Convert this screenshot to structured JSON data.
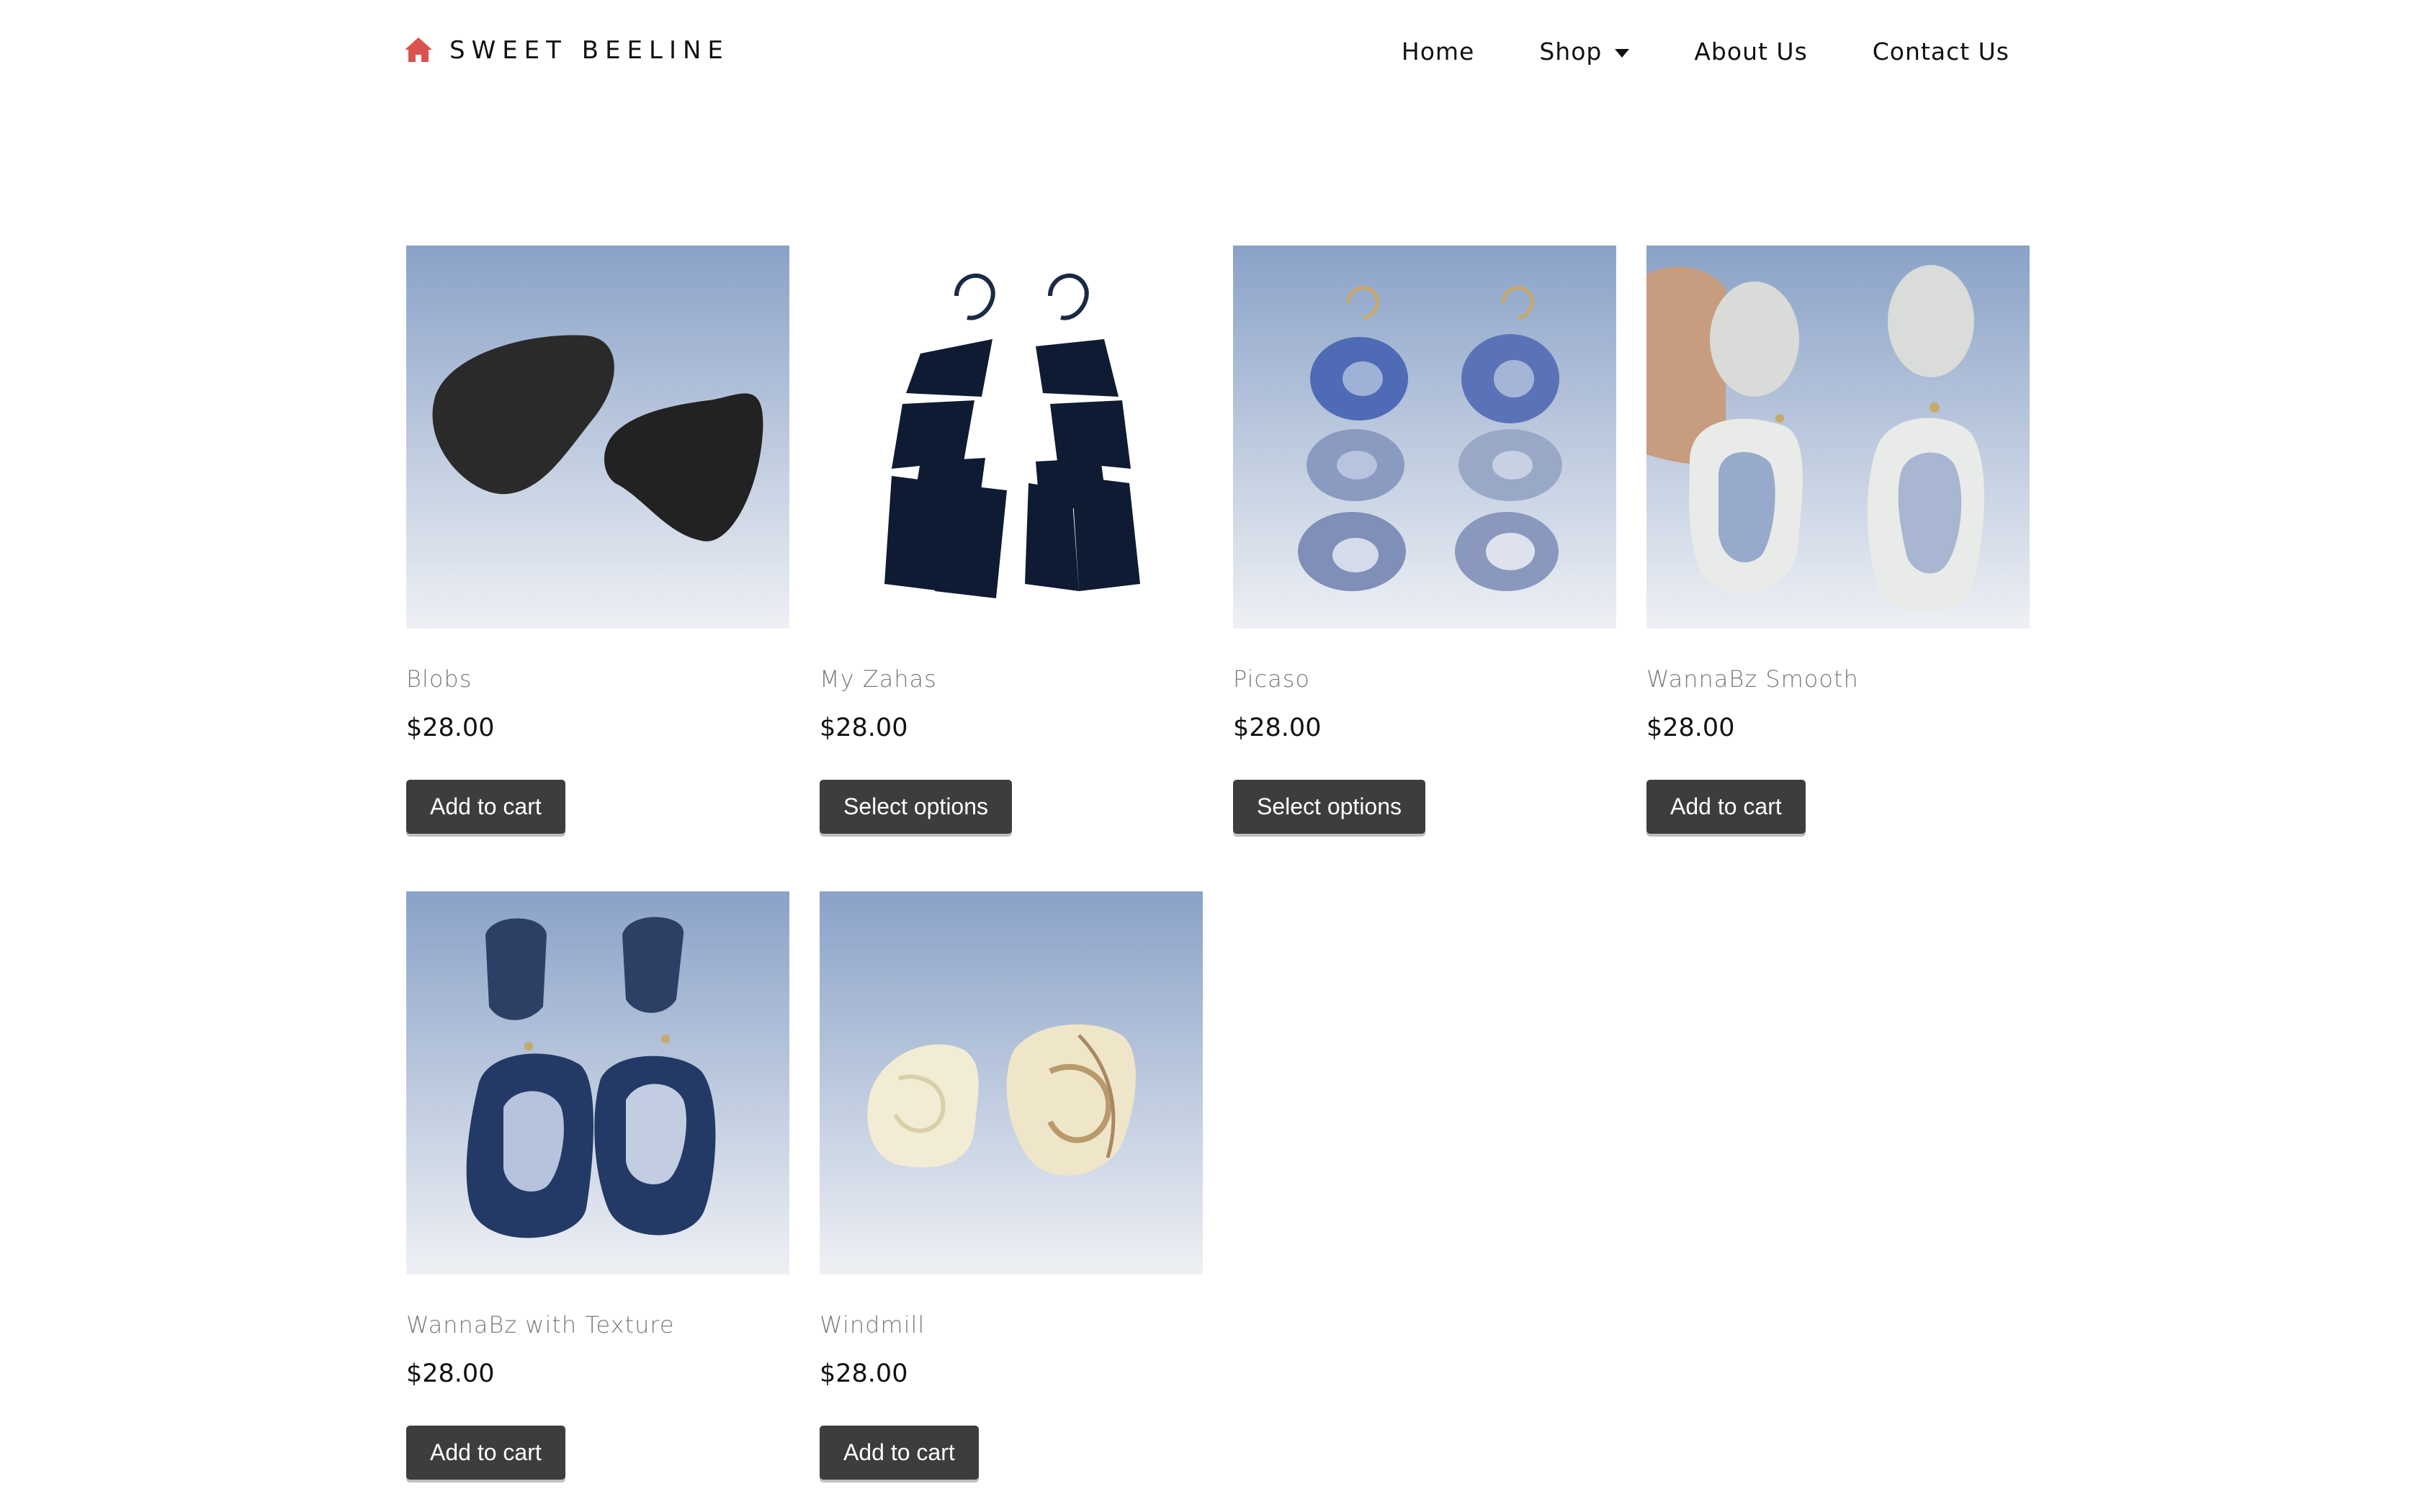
{
  "site": {
    "brand_name": "SWEET BEELINE",
    "brand_icon": "home-icon",
    "accent_color": "#d9534f"
  },
  "nav": {
    "items": [
      {
        "label": "Home"
      },
      {
        "label": "Shop",
        "has_dropdown": true
      },
      {
        "label": "About Us"
      },
      {
        "label": "Contact Us"
      }
    ]
  },
  "products": [
    {
      "title": "Blobs",
      "price": "$28.00",
      "button": "Add to cart",
      "image": "black-blob-earrings"
    },
    {
      "title": "My Zahas",
      "price": "$28.00",
      "button": "Select options",
      "image": "navy-geometric-dangle-earrings"
    },
    {
      "title": "Picaso",
      "price": "$28.00",
      "button": "Select options",
      "image": "blue-hoop-chain-earrings"
    },
    {
      "title": "WannaBz Smooth",
      "price": "$28.00",
      "button": "Add to cart",
      "image": "white-stone-drop-earrings"
    },
    {
      "title": "WannaBz with Texture",
      "price": "$28.00",
      "button": "Add to cart",
      "image": "navy-textured-drop-earrings"
    },
    {
      "title": "Windmill",
      "price": "$28.00",
      "button": "Add to cart",
      "image": "cream-swirl-stud-earrings"
    }
  ],
  "colors": {
    "button_bg": "#3d3d3d",
    "button_text": "#ffffff",
    "title_text": "#7a7a7a",
    "price_text": "#111111",
    "sky_top": "#8aa2c8",
    "sky_bottom": "#eef0f4"
  }
}
